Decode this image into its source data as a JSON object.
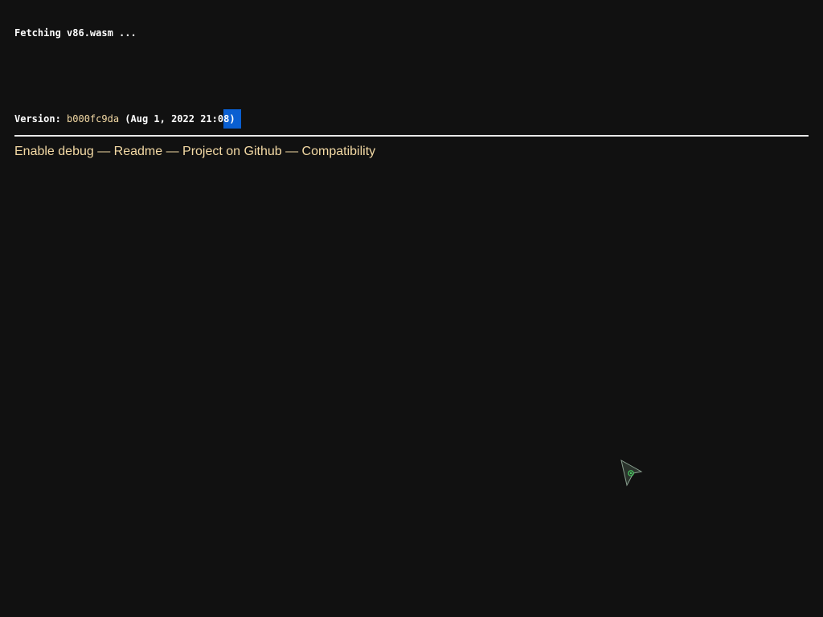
{
  "status": {
    "loading_text": "Fetching v86.wasm ..."
  },
  "version": {
    "label": "Version: ",
    "hash": "b000fc9da",
    "date_text": " (Aug 1, 2022 21:0",
    "selected_text": "8)"
  },
  "footer": {
    "separator": " — ",
    "links": [
      {
        "label": "Enable debug"
      },
      {
        "label": "Readme"
      },
      {
        "label": "Project on Github"
      },
      {
        "label": "Compatibility"
      }
    ]
  },
  "colors": {
    "background": "#111111",
    "text": "#ffffff",
    "link": "#f3d9a4",
    "selection": "#0a5fd1",
    "rule": "#e8e8e8"
  },
  "icons": {
    "cursor": "arrow-pointer-icon"
  }
}
